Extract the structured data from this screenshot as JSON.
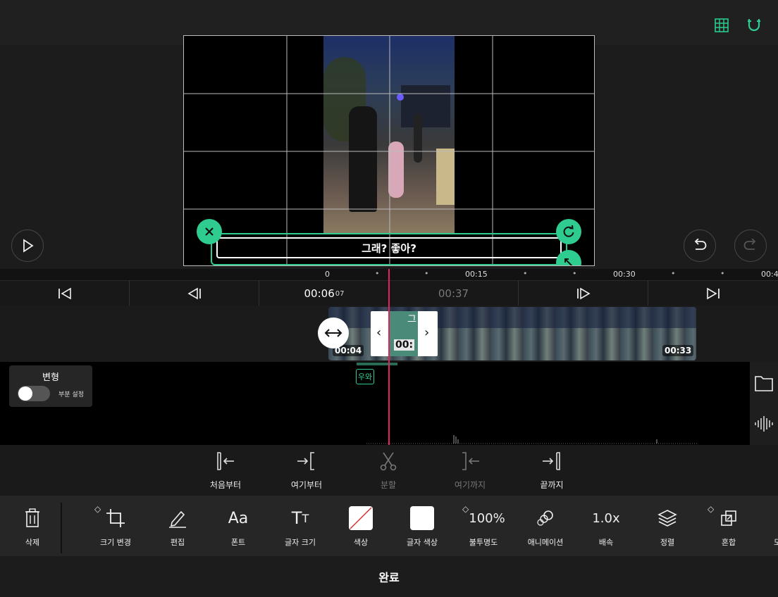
{
  "colors": {
    "accent": "#2ecc8f",
    "playhead": "#e0245e",
    "panel": "#262626"
  },
  "topbar": {
    "grid_icon": "grid-icon",
    "magnet_icon": "magnet-icon"
  },
  "preview": {
    "caption_text": "그래? 좋아?",
    "play_icon": "play-icon",
    "undo_icon": "undo-icon",
    "redo_icon": "redo-icon"
  },
  "ruler": {
    "ticks": [
      "0",
      "00:15",
      "00:30",
      "00:4"
    ]
  },
  "transport": {
    "current_time": "00:06",
    "current_frames": "07",
    "total_time": "00:37"
  },
  "track": {
    "clip_start_label": "00:04",
    "clip_end_label": "00:33",
    "selected_clip_text": "그",
    "selected_clip_time": "00:",
    "text_clip_label": "우와"
  },
  "transform_panel": {
    "title": "변형",
    "toggle_label": "부분 설정"
  },
  "split_bar": {
    "from_start": "처음부터",
    "from_here": "여기부터",
    "split": "분할",
    "to_here": "여기까지",
    "to_end": "끝까지"
  },
  "toolbar": {
    "delete": "삭제",
    "resize": "크기 변경",
    "edit": "편집",
    "font": "폰트",
    "font_size": "글자 크기",
    "color": "색상",
    "text_color": "글자 색상",
    "opacity_value": "100%",
    "opacity": "불투명도",
    "animation": "애니메이션",
    "speed_value": "1.0x",
    "speed": "배속",
    "arrange": "정렬",
    "blend": "혼합",
    "more": "모"
  },
  "done": {
    "label": "완료"
  }
}
